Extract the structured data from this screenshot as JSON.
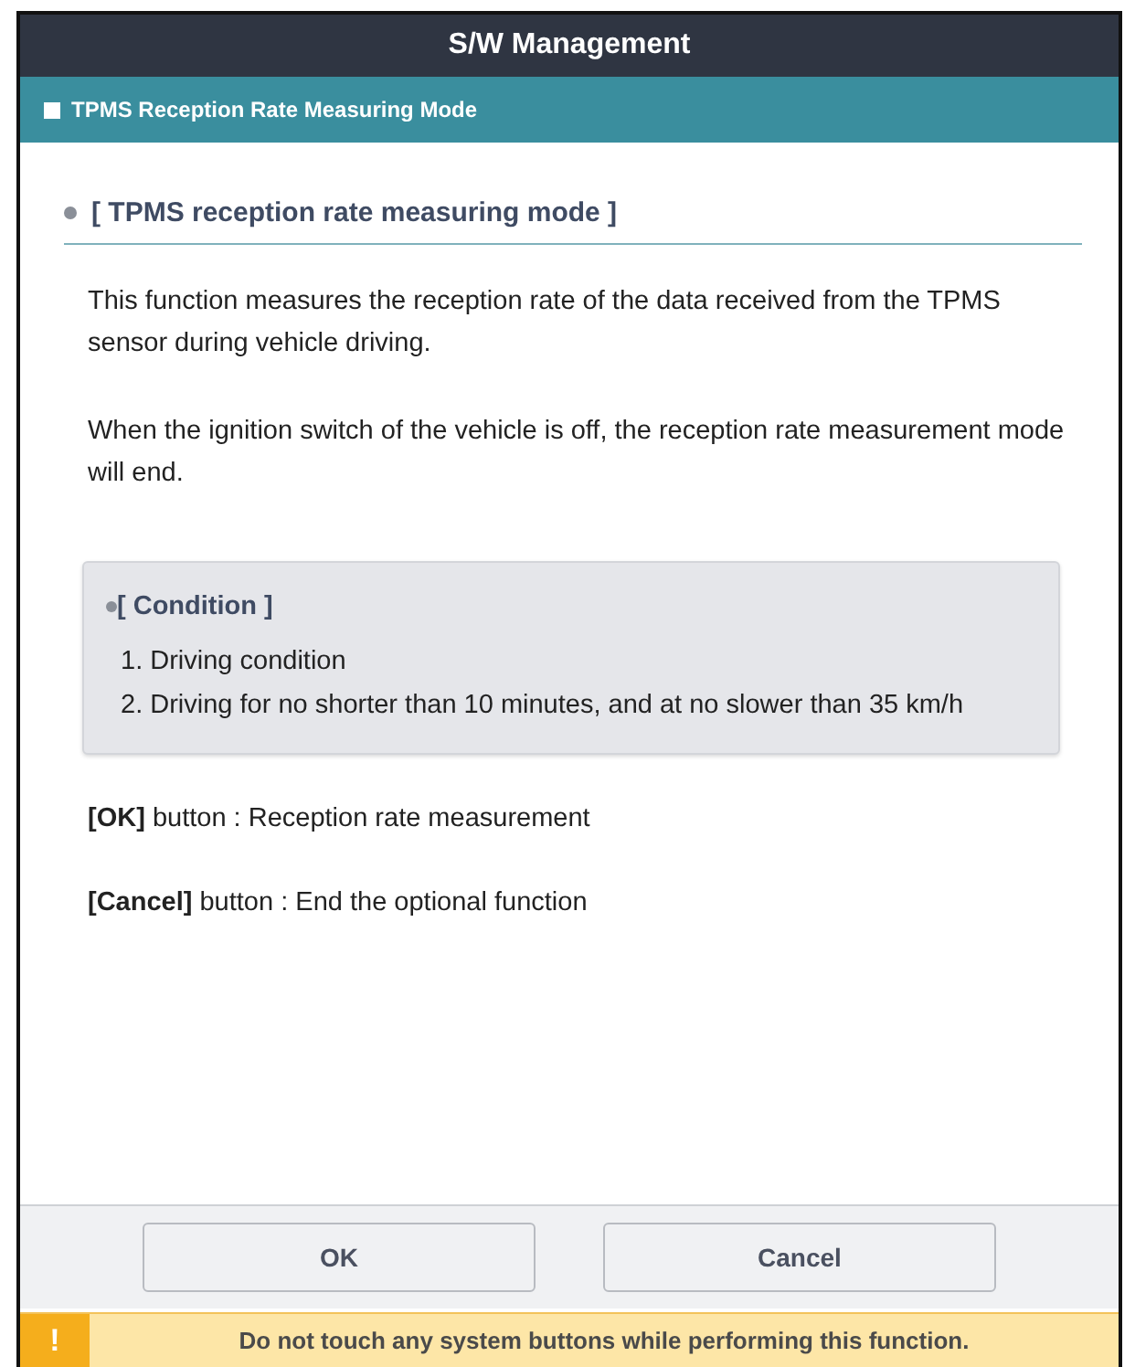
{
  "window": {
    "title": "S/W Management"
  },
  "header": {
    "title": "TPMS Reception Rate Measuring Mode"
  },
  "section": {
    "heading": "[ TPMS reception rate measuring mode ]",
    "paragraphs": [
      "This function measures the reception rate of the data received from the TPMS sensor during vehicle driving.",
      "When the ignition switch of the vehicle is off, the reception rate measurement mode will end."
    ]
  },
  "condition": {
    "heading": "[ Condition ]",
    "items": [
      "1. Driving condition",
      "2. Driving for no shorter than 10 minutes, and at no slower than 35 km/h"
    ]
  },
  "button_notes": [
    "**[OK]** button : Reception rate measurement",
    "**[Cancel]** button : End the optional function"
  ],
  "buttons": [
    "OK",
    "Cancel"
  ],
  "warning": {
    "icon": "!",
    "text": "Do not touch any system buttons while performing this function."
  }
}
